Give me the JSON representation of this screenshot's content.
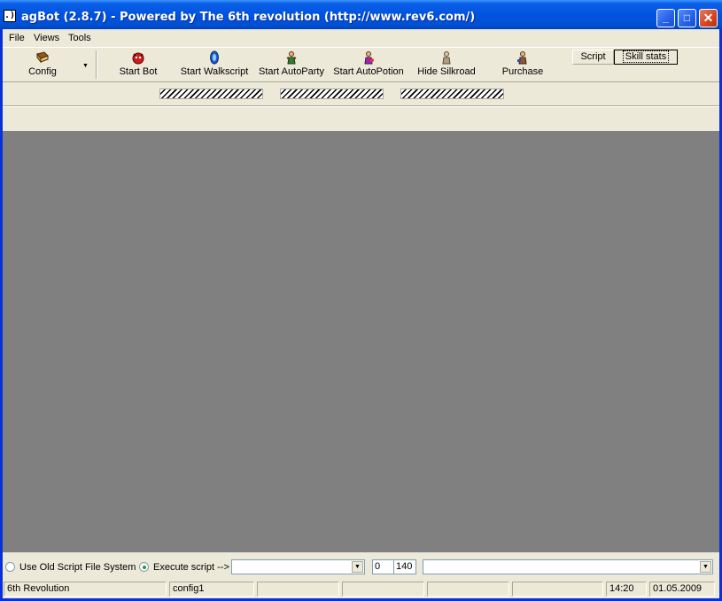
{
  "window": {
    "title": "agBot (2.8.7) - Powered by The 6th revolution (http://www.rev6.com/)",
    "app_icon": ".)",
    "controls": {
      "minimize": "_",
      "maximize": "□",
      "close": "✕"
    }
  },
  "menu": {
    "file": "File",
    "views": "Views",
    "tools": "Tools"
  },
  "toolbar": {
    "config": "Config",
    "start_bot": "Start Bot",
    "start_walkscript": "Start Walkscript",
    "start_autoparty": "Start AutoParty",
    "start_autopotion": "Start AutoPotion",
    "hide_silkroad": "Hide Silkroad",
    "purchase": "Purchase",
    "script_button": "Script",
    "skill_stats_button": "Skill stats"
  },
  "bottom": {
    "use_old_script": "Use Old Script File System",
    "execute_script": "Execute script -->",
    "num_a": "0",
    "num_b": "140"
  },
  "status": {
    "panel1": "6th Revolution",
    "panel2": "config1",
    "time": "14:20",
    "date": "01.05.2009"
  }
}
